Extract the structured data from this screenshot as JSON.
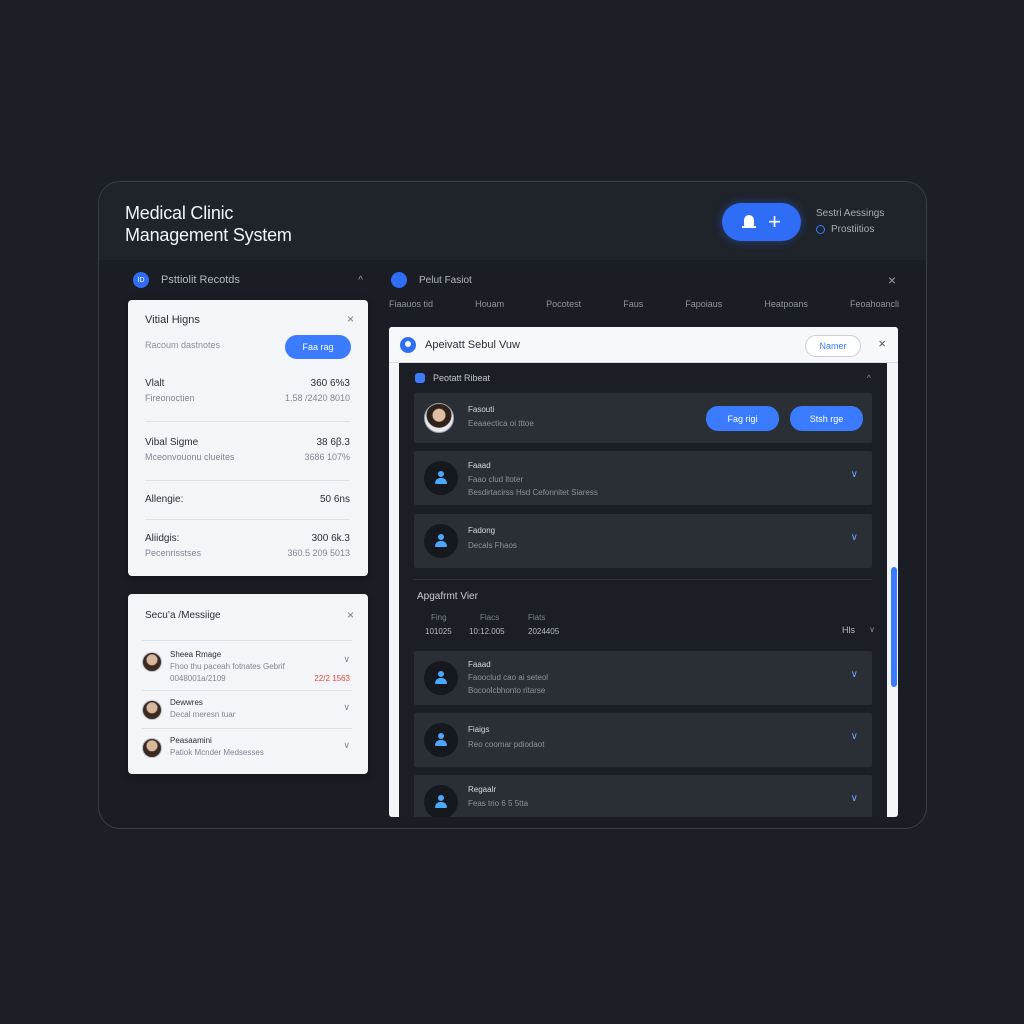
{
  "app": {
    "title_line1": "Medical Clinic",
    "title_line2": "Management System",
    "header_right_label": "Sestri Aessings",
    "header_right_status": "Prostiitios",
    "add_plus": "+"
  },
  "left": {
    "section_label": "Psttiolit Recotds",
    "section_icon": "ID",
    "chev": "^",
    "vitals_card": {
      "title": "Vitial Higns",
      "subtitle": "Racoum dastnotes",
      "button": "Faa rag",
      "close": "×",
      "rows": [
        {
          "k": "Vlalt",
          "v": "360 6%3",
          "k2": "Fireonoctien",
          "v2": "1.58 /2420 8010"
        },
        {
          "k": "Vibal Sigme",
          "v": "38 6β.3",
          "k2": "Mceonvouonu clueites",
          "v2": "3686 107%"
        },
        {
          "k": "Allengie:",
          "v": "50 6ns",
          "k2": "",
          "v2": ""
        },
        {
          "k": "Aliidgis:",
          "v": "300 6k.3",
          "k2": "Pecenrisstses",
          "v2": "360.5 209 5013"
        }
      ]
    },
    "messages_card": {
      "title": "Secu’a /Messiige",
      "close": "×",
      "items": [
        {
          "name": "Sheea Rmage",
          "preview": "Fhoo thu paceah fotnates Gebrif",
          "preview2": "0048001a/2109",
          "date": "22/2 1563"
        },
        {
          "name": "Dewwres",
          "preview": "Decal meresn tuar",
          "preview2": "",
          "date": ""
        },
        {
          "name": "Peasaamini",
          "preview": "Patiok Mcnder Medsesses",
          "preview2": "",
          "date": ""
        }
      ]
    }
  },
  "right": {
    "section_label": "Pelut Fasiot",
    "close": "×",
    "tabs": [
      "Fiaauos tid",
      "Houam",
      "Pocotest",
      "Faus",
      "Fapoiaus",
      "Heatpoans",
      "Feoahoancli"
    ],
    "panel": {
      "title": "Apeivatt Sebul Vuw",
      "name_button": "Namer",
      "close": "×",
      "inner_title": "Peotatt Ribeat",
      "inner_chev": "^",
      "profile": {
        "name": "Fasouti",
        "detail": "Eeaaectica oi tttoe",
        "btn1": "Fag rigi",
        "btn2": "Stsh rge"
      },
      "records": [
        {
          "t1": "Faaad",
          "t2": "Faao clud ltoter",
          "t3": "Besdirtacirss Hsd Cefonnitet Siaress"
        },
        {
          "t1": "Fadong",
          "t2": "Decals Fhaos",
          "t3": ""
        }
      ],
      "appointment": {
        "title": "Apgafrmt Vier",
        "cols": [
          "Fing",
          "Fiacs",
          "Fiats"
        ],
        "vals": [
          "101025",
          "10:12.005",
          "2024405"
        ],
        "right": "Hls",
        "right2": "∨"
      },
      "appt_records": [
        {
          "t1": "Faaad",
          "t2": "Faooclud cao ai seteol",
          "t3": "Bocoolcbhonto ritarse"
        },
        {
          "t1": "Fiaigs",
          "t2": "Reo coomar pdiodaot",
          "t3": ""
        },
        {
          "t1": "Regaalr",
          "t2": "Feas  trio 6 5 5tta",
          "t3": ""
        }
      ]
    }
  }
}
